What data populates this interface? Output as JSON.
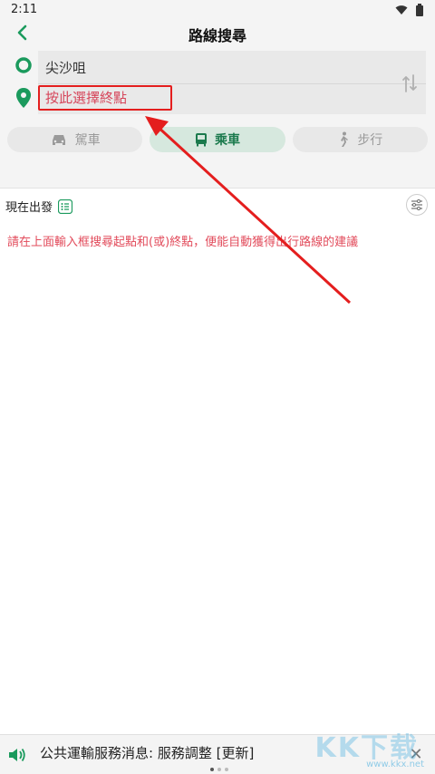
{
  "status_bar": {
    "time": "2:11"
  },
  "header": {
    "title": "路線搜尋"
  },
  "search": {
    "origin_value": "尖沙咀",
    "destination_placeholder": "按此選擇終點"
  },
  "modes": [
    {
      "label": "駕車",
      "icon": "car-icon"
    },
    {
      "label": "乘車",
      "icon": "bus-icon",
      "active": true
    },
    {
      "label": "步行",
      "icon": "walk-icon"
    }
  ],
  "content": {
    "depart_label": "現在出發",
    "hint_text": "請在上面輸入框搜尋起點和(或)終點，便能自動獲得出行路線的建議"
  },
  "news": {
    "text": "公共運輸服務消息: 服務調整 [更新]"
  },
  "watermark": {
    "logo_text": "KK下载",
    "url": "www.kkx.net"
  },
  "colors": {
    "accent": "#1b9a5d",
    "hint": "#e24b5b",
    "annotation": "#e41e1e"
  }
}
